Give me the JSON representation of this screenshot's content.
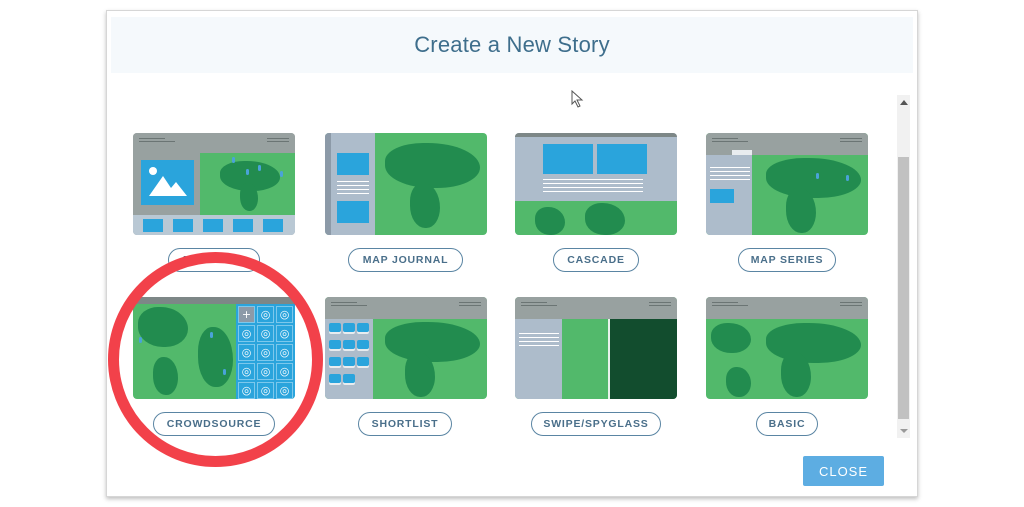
{
  "dialog": {
    "title": "Create a New Story",
    "close_label": "CLOSE"
  },
  "templates": [
    {
      "label": "MAP TOUR",
      "icon": "map-tour-thumbnail"
    },
    {
      "label": "MAP JOURNAL",
      "icon": "map-journal-thumbnail"
    },
    {
      "label": "CASCADE",
      "icon": "cascade-thumbnail"
    },
    {
      "label": "MAP SERIES",
      "icon": "map-series-thumbnail"
    },
    {
      "label": "CROWDSOURCE",
      "icon": "crowdsource-thumbnail"
    },
    {
      "label": "SHORTLIST",
      "icon": "shortlist-thumbnail"
    },
    {
      "label": "SWIPE/SPYGLASS",
      "icon": "swipe-spyglass-thumbnail"
    },
    {
      "label": "BASIC",
      "icon": "basic-thumbnail"
    }
  ],
  "annotation": {
    "type": "red-circle",
    "highlights": "CROWDSOURCE",
    "color": "#f2414a"
  },
  "colors": {
    "title": "#3e6e8c",
    "button_border": "#5a85a3",
    "close_bg": "#5dade2",
    "map_green": "#52b96b",
    "land_green": "#228c4f",
    "photo_blue": "#2aa4dc"
  }
}
